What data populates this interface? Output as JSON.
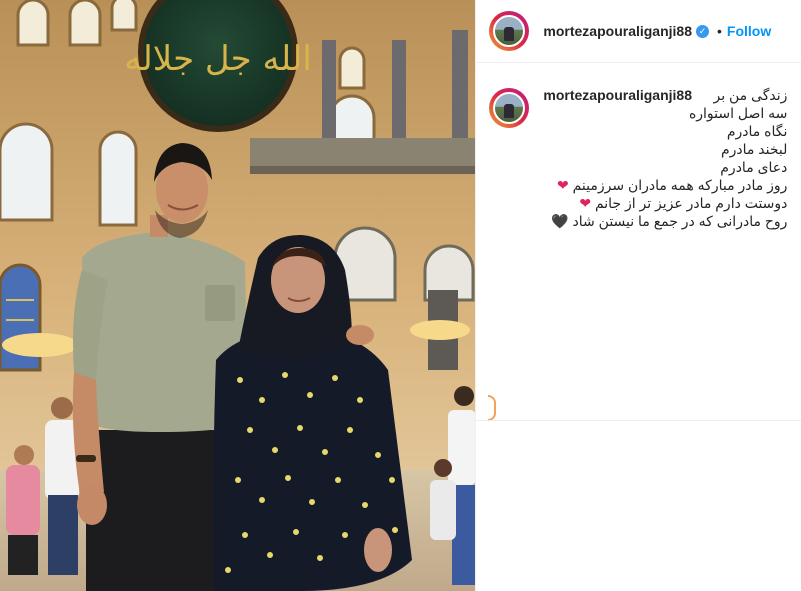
{
  "post": {
    "author": {
      "username": "mortezapouraliganji88",
      "verified_mark": "✓",
      "separator": "•",
      "follow_label": "Follow"
    },
    "caption": {
      "username": "mortezapouraliganji88",
      "lines": [
        "زندگی من بر",
        "سه اصل استواره",
        "نگاه مادرم",
        "لبخند مادرم",
        "دعای مادرم",
        "روز مادر مبارکه همه مادران سرزمینم",
        "دوستت دارم مادر عزیز تر از جانم",
        "روح مادرانی که در جمع ما نیستن شاد"
      ],
      "emoji": {
        "heart_red": "❤",
        "heart_black": "🖤"
      }
    },
    "photo": {
      "calligraphy_text": "الله جل جلاله"
    }
  },
  "colors": {
    "follow": "#0095f6",
    "verified": "#3897f0",
    "text": "#262626"
  }
}
